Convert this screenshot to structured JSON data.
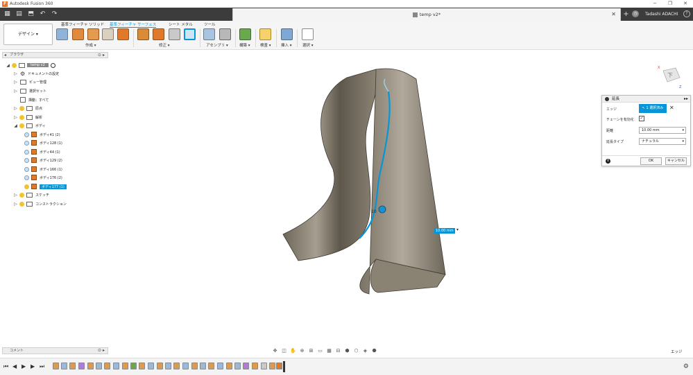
{
  "titlebar": {
    "title": "Autodesk Fusion 360",
    "logo_letter": "F",
    "minimize": "─",
    "maximize": "❐",
    "close": "✕"
  },
  "quickaccess": {
    "grid": "▦",
    "file": "▤",
    "save": "⬒",
    "undo": "↶",
    "redo": "↷"
  },
  "document": {
    "tab_title": "temp v2*",
    "close": "✕",
    "plus": "+",
    "user": "Tadashi ADACHI",
    "help": "?",
    "clock": "◷"
  },
  "ribbon": {
    "workspace": "デザイン ▾",
    "tabs": [
      "基準フィーチャ ソリッド",
      "基準フィーチャ サーフェス",
      "シート メタル",
      "ツール"
    ],
    "active_tab": 1,
    "groups": [
      "作成 ▾",
      "修正 ▾",
      "アセンブリ ▾",
      "構築 ▾",
      "検査 ▾",
      "挿入 ▾",
      "選択 ▾"
    ]
  },
  "browser": {
    "header": "ブラウザ",
    "collapse": "◂",
    "root": "temp v2",
    "items": [
      "ドキュメントの設定",
      "ビュー管理",
      "選択セット",
      "挿動：すべて",
      "原点",
      "解析",
      "ボディ",
      "ボディ41 (2)",
      "ボディ128 (1)",
      "ボディ44 (1)",
      "ボディ129 (2)",
      "ボディ166 (1)",
      "ボディ176 (2)",
      "ボディ177 (1)",
      "スケッチ",
      "コンストラクション"
    ]
  },
  "viewcube": {
    "face": "下",
    "axis_x": "X",
    "axis_z": "Z"
  },
  "panel": {
    "title": "延長",
    "edge_label": "エッジ",
    "edge_button": "1 選択済み",
    "chain_label": "チェーンを有効化",
    "chain_checked": "✓",
    "distance_label": "距離",
    "distance_value": "10.00 mm",
    "type_label": "延長タイプ",
    "type_value": "ナチュラル",
    "ok": "OK",
    "cancel": "キャンセル",
    "info": "i",
    "more": "▸▸"
  },
  "canvas": {
    "dim_value": "10.00 mm",
    "dim_label": "10"
  },
  "comment": {
    "label": "コメント"
  },
  "status": {
    "text": "エッジ"
  },
  "timeline": {
    "first": "⏮",
    "prev": "◀",
    "play": "▶",
    "next": "▶",
    "last": "⏭",
    "settings": "⚙"
  },
  "colors": {
    "accent": "#0696d7",
    "surface": "#8c8475"
  }
}
